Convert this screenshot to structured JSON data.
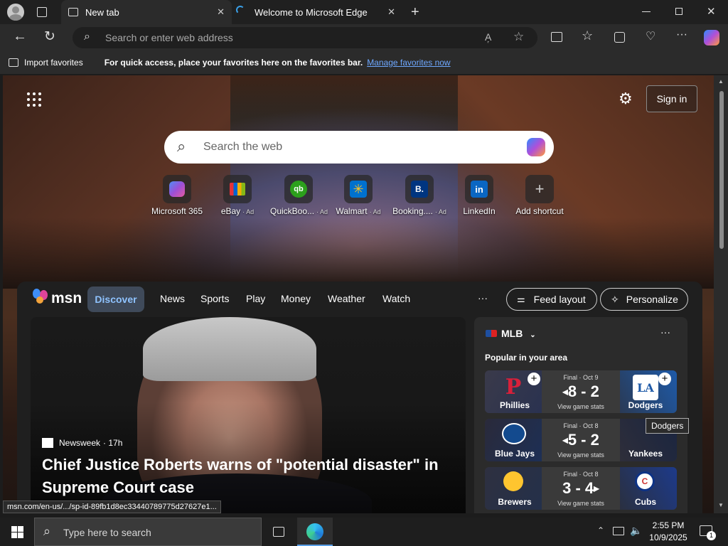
{
  "browser": {
    "tabs": [
      {
        "label": "New tab"
      },
      {
        "label": "Welcome to Microsoft Edge"
      }
    ],
    "address_placeholder": "Search or enter web address",
    "favbar": {
      "import_label": "Import favorites",
      "message": "For quick access, place your favorites here on the favorites bar.",
      "manage_link": "Manage favorites now"
    },
    "status_url": "msn.com/en-us/.../sp-id-89fb1d8ec33440789775d27627e1..."
  },
  "newtab": {
    "sign_in": "Sign in",
    "search_placeholder": "Search the web",
    "quick_links": [
      {
        "label": "Microsoft 365",
        "ad": ""
      },
      {
        "label": "eBay",
        "ad": "· Ad"
      },
      {
        "label": "QuickBoo...",
        "ad": "· Ad"
      },
      {
        "label": "Walmart",
        "ad": "· Ad"
      },
      {
        "label": "Booking....",
        "ad": "· Ad"
      },
      {
        "label": "LinkedIn",
        "ad": ""
      },
      {
        "label": "Add shortcut",
        "ad": ""
      }
    ]
  },
  "feed": {
    "brand": "msn",
    "nav": [
      "Discover",
      "News",
      "Sports",
      "Play",
      "Money",
      "Weather",
      "Watch"
    ],
    "more": "···",
    "feed_layout": "Feed layout",
    "personalize": "Personalize",
    "hero": {
      "source": "Newsweek",
      "age": "· 17h",
      "headline": "Chief Justice Roberts warns of \"potential disaster\" in Supreme Court case"
    },
    "sports": {
      "league": "MLB",
      "subtitle": "Popular in your area",
      "view_stats": "View game stats",
      "tooltip": "Dodgers",
      "games": [
        {
          "status": "Final · Oct 9",
          "home": "Phillies",
          "away": "Dodgers",
          "score": "8 - 2",
          "home_logo": "P",
          "away_logo": "LA"
        },
        {
          "status": "Final · Oct 8",
          "home": "Blue Jays",
          "away": "Yankees",
          "score": "5 - 2",
          "home_logo": "",
          "away_logo": ""
        },
        {
          "status": "Final · Oct 8",
          "home": "Brewers",
          "away": "Cubs",
          "score": "3 - 4",
          "home_logo": "",
          "away_logo": "C"
        }
      ]
    }
  },
  "taskbar": {
    "search_placeholder": "Type here to search",
    "time": "2:55 PM",
    "date": "10/9/2025",
    "notification_count": "1"
  },
  "colors": {
    "accent_link": "#6ea8ff",
    "discover_pill": "#3f4a5a",
    "phillies": "#d8203a",
    "dodgers": "#1e5aa8",
    "bluejays": "#134a8e"
  }
}
